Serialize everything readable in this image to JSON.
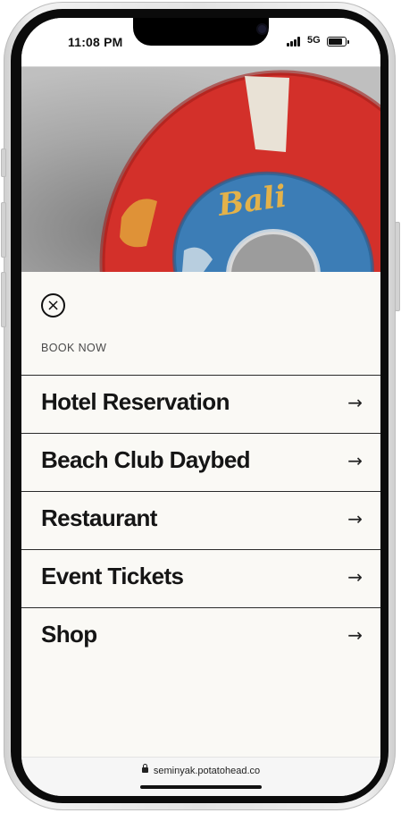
{
  "status_bar": {
    "time": "11:08 PM",
    "network": "5G",
    "icons": [
      "signal-icon",
      "battery-icon"
    ]
  },
  "hero": {
    "image": "lifebuoy-photo",
    "script_text": "Bali",
    "colors": {
      "ring": "#d7322c",
      "center": "#3d7fb8",
      "background": "#b0b0b0"
    }
  },
  "panel": {
    "close_icon": "close-icon",
    "section_label": "BOOK NOW",
    "items": [
      {
        "label": "Hotel Reservation",
        "arrow": "→"
      },
      {
        "label": "Beach Club Daybed",
        "arrow": "→"
      },
      {
        "label": "Restaurant",
        "arrow": "→"
      },
      {
        "label": "Event Tickets",
        "arrow": "→"
      },
      {
        "label": "Shop",
        "arrow": "→"
      }
    ]
  },
  "url_bar": {
    "url": "seminyak.potatohead.co",
    "icon": "lock-icon"
  }
}
